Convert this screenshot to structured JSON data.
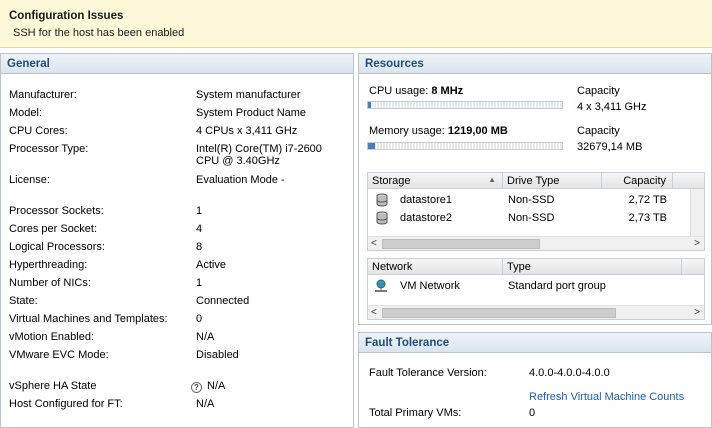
{
  "config_issues": {
    "title": "Configuration Issues",
    "message": "SSH for the host has been enabled"
  },
  "general": {
    "title": "General",
    "rows": [
      {
        "label": "Manufacturer:",
        "value": "System manufacturer"
      },
      {
        "label": "Model:",
        "value": "System Product Name"
      },
      {
        "label": "CPU Cores:",
        "value": "4 CPUs x 3,411 GHz"
      },
      {
        "label": "Processor Type:",
        "value": "Intel(R) Core(TM) i7-2600",
        "value2": "CPU @ 3.40GHz"
      },
      {
        "label": "License:",
        "value": "Evaluation Mode -"
      },
      {
        "label": "Processor Sockets:",
        "value": "1"
      },
      {
        "label": "Cores per Socket:",
        "value": "4"
      },
      {
        "label": "Logical Processors:",
        "value": "8"
      },
      {
        "label": "Hyperthreading:",
        "value": "Active"
      },
      {
        "label": "Number of NICs:",
        "value": "1"
      },
      {
        "label": "State:",
        "value": "Connected"
      },
      {
        "label": "Virtual Machines and Templates:",
        "value": "0"
      },
      {
        "label": "vMotion Enabled:",
        "value": "N/A"
      },
      {
        "label": "VMware EVC Mode:",
        "value": "Disabled"
      },
      {
        "label": "vSphere HA State",
        "value": "N/A",
        "icon": "help-icon"
      },
      {
        "label": "Host Configured for FT:",
        "value": "N/A"
      }
    ]
  },
  "resources": {
    "title": "Resources",
    "cpu": {
      "label": "CPU usage:",
      "value": "8 MHz",
      "capacity_label": "Capacity",
      "capacity": "4 x 3,411 GHz",
      "fraction": 0.0006
    },
    "memory": {
      "label": "Memory usage:",
      "value": "1219,00 MB",
      "capacity_label": "Capacity",
      "capacity": "32679,14 MB",
      "fraction": 0.037
    },
    "storage_table": {
      "headers": [
        "Storage",
        "Drive Type",
        "Capacity"
      ],
      "rows": [
        {
          "name": "datastore1",
          "drive_type": "Non-SSD",
          "capacity": "2,72 TB"
        },
        {
          "name": "datastore2",
          "drive_type": "Non-SSD",
          "capacity": "2,73 TB"
        }
      ]
    },
    "network_table": {
      "headers": [
        "Network",
        "Type"
      ],
      "rows": [
        {
          "name": "VM Network",
          "type": "Standard port group"
        }
      ]
    }
  },
  "fault_tolerance": {
    "title": "Fault Tolerance",
    "version_label": "Fault Tolerance Version:",
    "version": "4.0.0-4.0.0-4.0.0",
    "refresh_link": "Refresh Virtual Machine Counts",
    "primary_label": "Total Primary VMs:",
    "primary_value": "0"
  },
  "colors": {
    "accent": "#1f4d7b",
    "link": "#1a5fb4",
    "banner_bg": "#fdf9d9",
    "meter_fill": "#4a7ab8"
  }
}
